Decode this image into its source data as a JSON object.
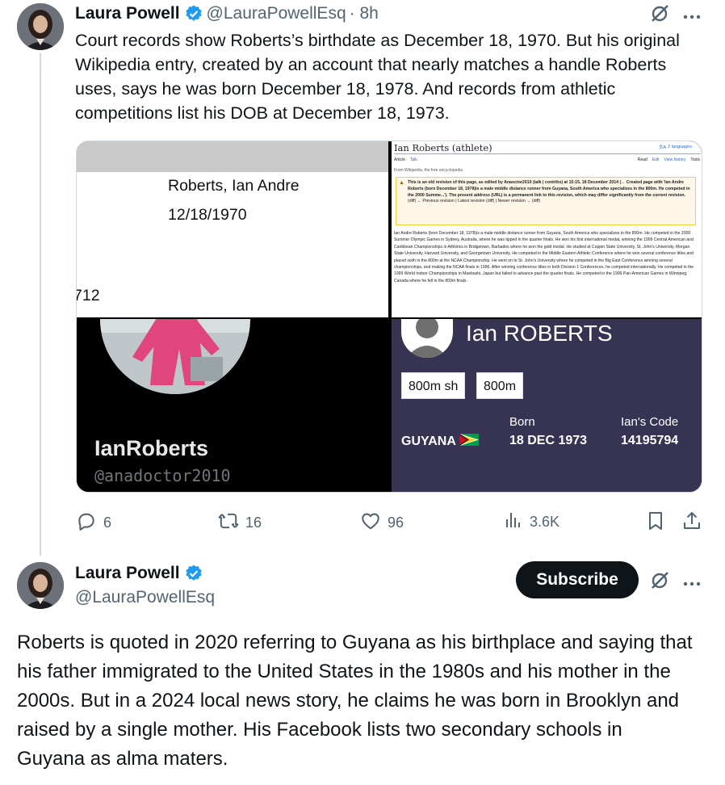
{
  "tweet1": {
    "author_name": "Laura Powell",
    "author_handle": "@LauraPowellEsq",
    "time": "· 8h",
    "text": "Court records show Roberts’s birthdate as December 18, 1970. But his original Wikipedia entry, created by an account that nearly matches a handle Roberts uses, says he was born December 18, 1978. And records from athletic competitions list his DOB at December 18, 1973.",
    "media": {
      "court_record": {
        "name": "Roberts, Ian Andre",
        "date": "12/18/1970",
        "fragment": "712"
      },
      "wiki": {
        "title": "Ian Roberts (athlete)",
        "languages": "2 languages",
        "tab_article": "Article",
        "tab_talk": "Talk",
        "tab_read": "Read",
        "tab_edit": "Edit",
        "tab_history": "View history",
        "tab_tools": "Tools",
        "from": "From Wikipedia, the free encyclopedia",
        "notice": "This is an old revision of this page, as edited by Anaoctor2010 (talk | contribs) at 15:15, 18 December 2014 (← Created page with 'Ian Andre Roberts (born December 18, 1978)is a male middle distance runner from Guyana, South America who specializes in the 800m. He competed in the 2000 Summe...'). The present address (URL) is a permanent link to this revision, which may differ significantly from the current revision.",
        "nav": "(diff) ← Previous revision | Latest revision (diff) | Newer revision → (diff)",
        "body": "Ian Andre Roberts (born December 18, 1978)is a male middle distance runner from Guyana, South America who specializes in the 800m. He competed in the 2000 Summer Olympic Games in Sydney, Australia, where he was tipped in the quarter finals. He won his first international medal, winning the 1999 Central American and Caribbean Championships in Athletics in Bridgetown, Barbados where he won the gold medal. He studied at Coppin State University, St. John's University, Morgan State University, Harvard University, and Georgetown University. He competed in the Middle Eastern Athletic Conference where he won several conference titles and placed sixth in the 800m at the NCAA Championship. He went on to St. John's University where he competed in the Big East Conference winning several championships, and making the NCAA finals in 1996. After winning conference titles in both Division 1 Conferences, he competed internationally. He competed in the 1999 World Indoor Championships in Maebashi, Japan but failed to advance past the quarter finals. He competed in the 1999 Pan-American Games in Winnipeg, Canada where he fell in the 800m finals."
      },
      "profile": {
        "display_name": "IanRoberts",
        "handle": "@anadoctor2010"
      },
      "athlete_card": {
        "name": "Ian ROBERTS",
        "events": [
          "800m sh",
          "800m"
        ],
        "country": "GUYANA",
        "born_label": "Born",
        "born_value": "18 DEC 1973",
        "code_label": "Ian's Code",
        "code_value": "14195794"
      }
    },
    "actions": {
      "replies": "6",
      "reposts": "16",
      "likes": "96",
      "views": "3.6K"
    }
  },
  "tweet2": {
    "author_name": "Laura Powell",
    "author_handle": "@LauraPowellEsq",
    "subscribe_label": "Subscribe",
    "text": "Roberts is quoted in 2020 referring to Guyana as his birthplace and saying that his father immigrated to the United States in the 1980s and his mother in the 2000s. But in a 2024 local news story, he claims he was born in Brooklyn and raised by a single mother. His Facebook lists two secondary schools in Guyana as alma maters."
  },
  "icons": {
    "verified": "verified-badge-icon",
    "grok": "grok-icon",
    "more": "more-icon",
    "reply": "reply-icon",
    "repost": "repost-icon",
    "like": "like-icon",
    "views": "views-icon",
    "bookmark": "bookmark-icon",
    "share": "share-icon"
  },
  "colors": {
    "verified_blue": "#1d9bf0",
    "text_secondary": "#536471",
    "card_purple": "#373453"
  }
}
